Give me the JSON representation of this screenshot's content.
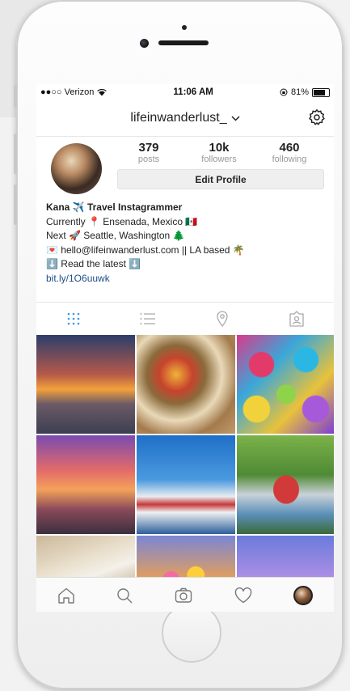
{
  "status_bar": {
    "carrier": "●●○○ Verizon",
    "time": "11:06 AM",
    "battery": "81%"
  },
  "header": {
    "username": "lifeinwanderlust_"
  },
  "stats": [
    {
      "value": "379",
      "label": "posts"
    },
    {
      "value": "10k",
      "label": "followers"
    },
    {
      "value": "460",
      "label": "following"
    }
  ],
  "edit_profile_label": "Edit Profile",
  "bio": {
    "name": "Kana ✈️ Travel Instagrammer",
    "line1": "Currently 📍 Ensenada, Mexico 🇲🇽",
    "line2": "Next 🚀 Seattle, Washington 🌲",
    "line3": "💌 hello@lifeinwanderlust.com || LA based 🌴",
    "line4": "⬇️ Read the latest ⬇️",
    "link": "bit.ly/1O6uuwk"
  },
  "tabs": [
    "grid",
    "list",
    "location",
    "tagged"
  ],
  "active_tab": "grid",
  "grid_photos": [
    "sunset-cruise-deck",
    "tacos",
    "sugar-skulls",
    "sunset-ship-rail",
    "cruise-ship-harbor",
    "red-japanese-bridge",
    "beach-waves",
    "cereal-bowl",
    "pastel-sky"
  ],
  "bottom_nav": [
    "home",
    "search",
    "camera",
    "activity",
    "profile"
  ],
  "colors": {
    "link": "#1d4e89",
    "active_tab": "#3897f0",
    "muted": "#999999"
  }
}
